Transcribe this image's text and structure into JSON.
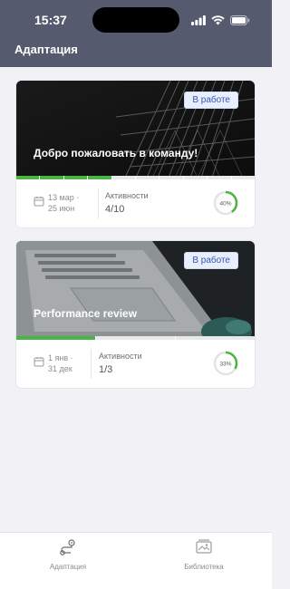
{
  "status_bar": {
    "time": "15:37"
  },
  "nav": {
    "title": "Адаптация"
  },
  "cards": [
    {
      "title": "Добро пожаловать в команду!",
      "badge": "В работе",
      "date_start": "13 мар",
      "date_end": "25 июн",
      "activities_label": "Активности",
      "activities_value": "4/10",
      "progress_percent": 40,
      "progress_label": "40%",
      "segments_total": 10,
      "segments_done": 4
    },
    {
      "title": "Performance review",
      "badge": "В работе",
      "date_start": "1 янв",
      "date_end": "31 дек",
      "activities_label": "Активности",
      "activities_value": "1/3",
      "progress_percent": 33,
      "progress_label": "33%",
      "segments_total": 3,
      "segments_done": 1
    }
  ],
  "tabbar": {
    "tabs": [
      {
        "label": "Адаптация",
        "icon": "route-icon"
      },
      {
        "label": "Библиотека",
        "icon": "library-icon"
      }
    ]
  },
  "colors": {
    "nav_bg": "#565a6e",
    "accent_green": "#4bb543",
    "badge_bg": "#e8eefc",
    "badge_text": "#3059b8"
  }
}
